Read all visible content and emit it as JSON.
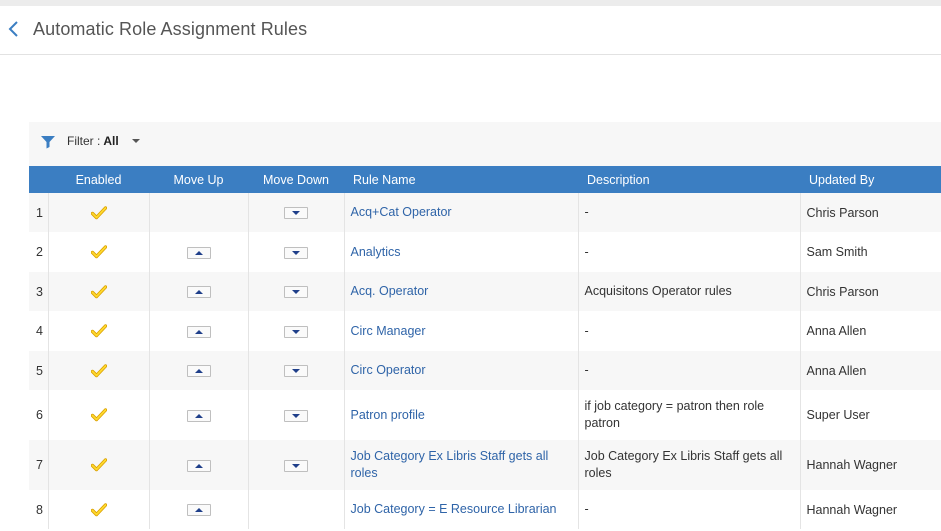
{
  "header": {
    "title": "Automatic Role Assignment Rules"
  },
  "filter": {
    "label": "Filter :",
    "value": "All"
  },
  "table": {
    "columns": [
      "",
      "Enabled",
      "Move Up",
      "Move Down",
      "Rule Name",
      "Description",
      "Updated By"
    ],
    "rows": [
      {
        "num": "1",
        "enabled": true,
        "move_up": false,
        "move_down": true,
        "rule_name": "Acq+Cat Operator",
        "description": "-",
        "updated_by": "Chris Parson"
      },
      {
        "num": "2",
        "enabled": true,
        "move_up": true,
        "move_down": true,
        "rule_name": "Analytics",
        "description": "-",
        "updated_by": "Sam Smith"
      },
      {
        "num": "3",
        "enabled": true,
        "move_up": true,
        "move_down": true,
        "rule_name": "Acq. Operator",
        "description": "Acquisitons Operator rules",
        "updated_by": "Chris Parson"
      },
      {
        "num": "4",
        "enabled": true,
        "move_up": true,
        "move_down": true,
        "rule_name": "Circ Manager",
        "description": "-",
        "updated_by": "Anna Allen"
      },
      {
        "num": "5",
        "enabled": true,
        "move_up": true,
        "move_down": true,
        "rule_name": "Circ Operator",
        "description": "-",
        "updated_by": "Anna Allen"
      },
      {
        "num": "6",
        "enabled": true,
        "move_up": true,
        "move_down": true,
        "rule_name": "Patron profile",
        "description": "if job category = patron then role patron",
        "updated_by": "Super User"
      },
      {
        "num": "7",
        "enabled": true,
        "move_up": true,
        "move_down": true,
        "rule_name": "Job Category Ex Libris Staff gets all roles",
        "description": "Job Category Ex Libris Staff gets all roles",
        "updated_by": "Hannah Wagner"
      },
      {
        "num": "8",
        "enabled": true,
        "move_up": true,
        "move_down": false,
        "rule_name": "Job Category = E Resource Librarian",
        "description": "-",
        "updated_by": "Hannah Wagner"
      }
    ]
  },
  "colors": {
    "header_bg": "#3b7ec2",
    "link": "#2f64a8",
    "check": "#f2c200"
  }
}
